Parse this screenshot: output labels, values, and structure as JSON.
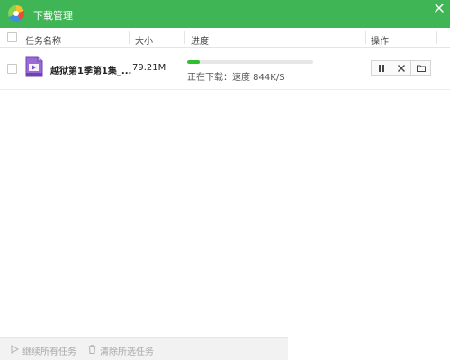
{
  "window": {
    "title": "下载管理"
  },
  "header": {
    "col_name": "任务名称",
    "col_size": "大小",
    "col_progress": "进度",
    "col_actions": "操作"
  },
  "tasks": [
    {
      "name": "越狱第1季第1集_...",
      "size": "79.21M",
      "progress_fraction": 0.1,
      "status": "正在下载：速度 844K/S",
      "progress_color": "#2ec12e"
    }
  ],
  "footer": {
    "resume_all": "继续所有任务",
    "clear_selected": "清除所选任务"
  },
  "colors": {
    "titlebar": "#3fb555",
    "progress": "#2ec12e",
    "file_icon": "#8b5cc9"
  },
  "icons": {
    "logo": "app-logo-icon",
    "close": "close-icon",
    "file": "video-file-icon",
    "pause": "pause-icon",
    "delete": "delete-icon",
    "folder": "folder-icon",
    "play": "play-icon",
    "trash": "trash-icon"
  }
}
